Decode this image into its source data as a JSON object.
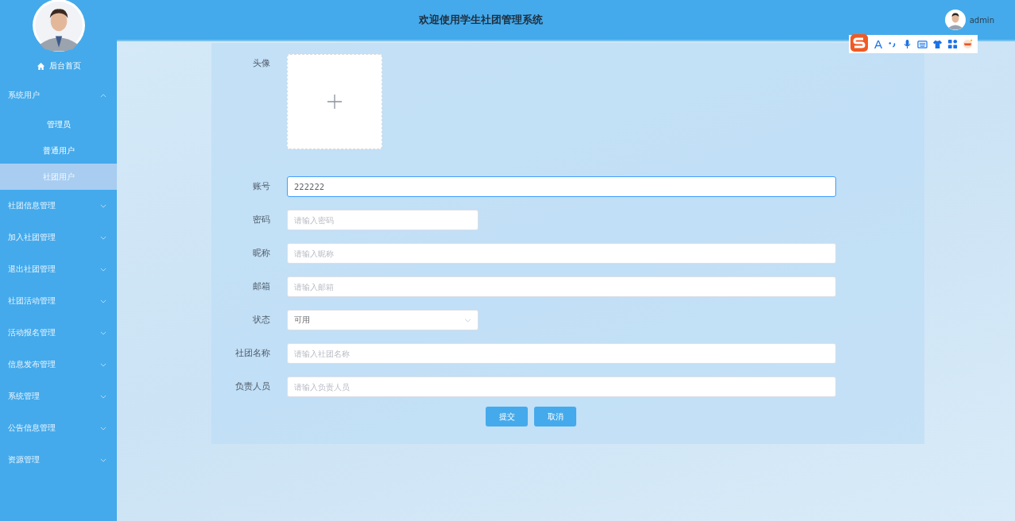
{
  "header": {
    "title": "欢迎使用学生社团管理系统",
    "user": "admin"
  },
  "ime_toolbar": {
    "letter": "A"
  },
  "sidebar": {
    "home": "后台首页",
    "groups": [
      {
        "label": "系统用户",
        "expanded": true,
        "children": [
          {
            "label": "管理员",
            "selected": false
          },
          {
            "label": "普通用户",
            "selected": false
          },
          {
            "label": "社团用户",
            "selected": true
          }
        ]
      },
      {
        "label": "社团信息管理",
        "expanded": false
      },
      {
        "label": "加入社团管理",
        "expanded": false
      },
      {
        "label": "退出社团管理",
        "expanded": false
      },
      {
        "label": "社团活动管理",
        "expanded": false
      },
      {
        "label": "活动报名管理",
        "expanded": false
      },
      {
        "label": "信息发布管理",
        "expanded": false
      },
      {
        "label": "系统管理",
        "expanded": false
      },
      {
        "label": "公告信息管理",
        "expanded": false
      },
      {
        "label": "资源管理",
        "expanded": false
      }
    ]
  },
  "form": {
    "fields": [
      {
        "kind": "upload",
        "label": "头像"
      },
      {
        "kind": "text",
        "label": "账号",
        "value": "222222",
        "focused": true
      },
      {
        "kind": "short-text",
        "label": "密码",
        "placeholder": "请输入密码",
        "focused": false
      },
      {
        "kind": "text",
        "label": "昵称",
        "placeholder": "请输入昵称",
        "focused": false
      },
      {
        "kind": "text",
        "label": "邮箱",
        "placeholder": "请输入邮箱",
        "focused": false
      },
      {
        "kind": "select",
        "label": "状态",
        "value": "可用"
      },
      {
        "kind": "text",
        "label": "社团名称",
        "placeholder": "请输入社团名称",
        "focused": false
      },
      {
        "kind": "text",
        "label": "负责人员",
        "placeholder": "请输入负责人员",
        "focused": false
      }
    ],
    "buttons": [
      "提交",
      "取消"
    ]
  }
}
